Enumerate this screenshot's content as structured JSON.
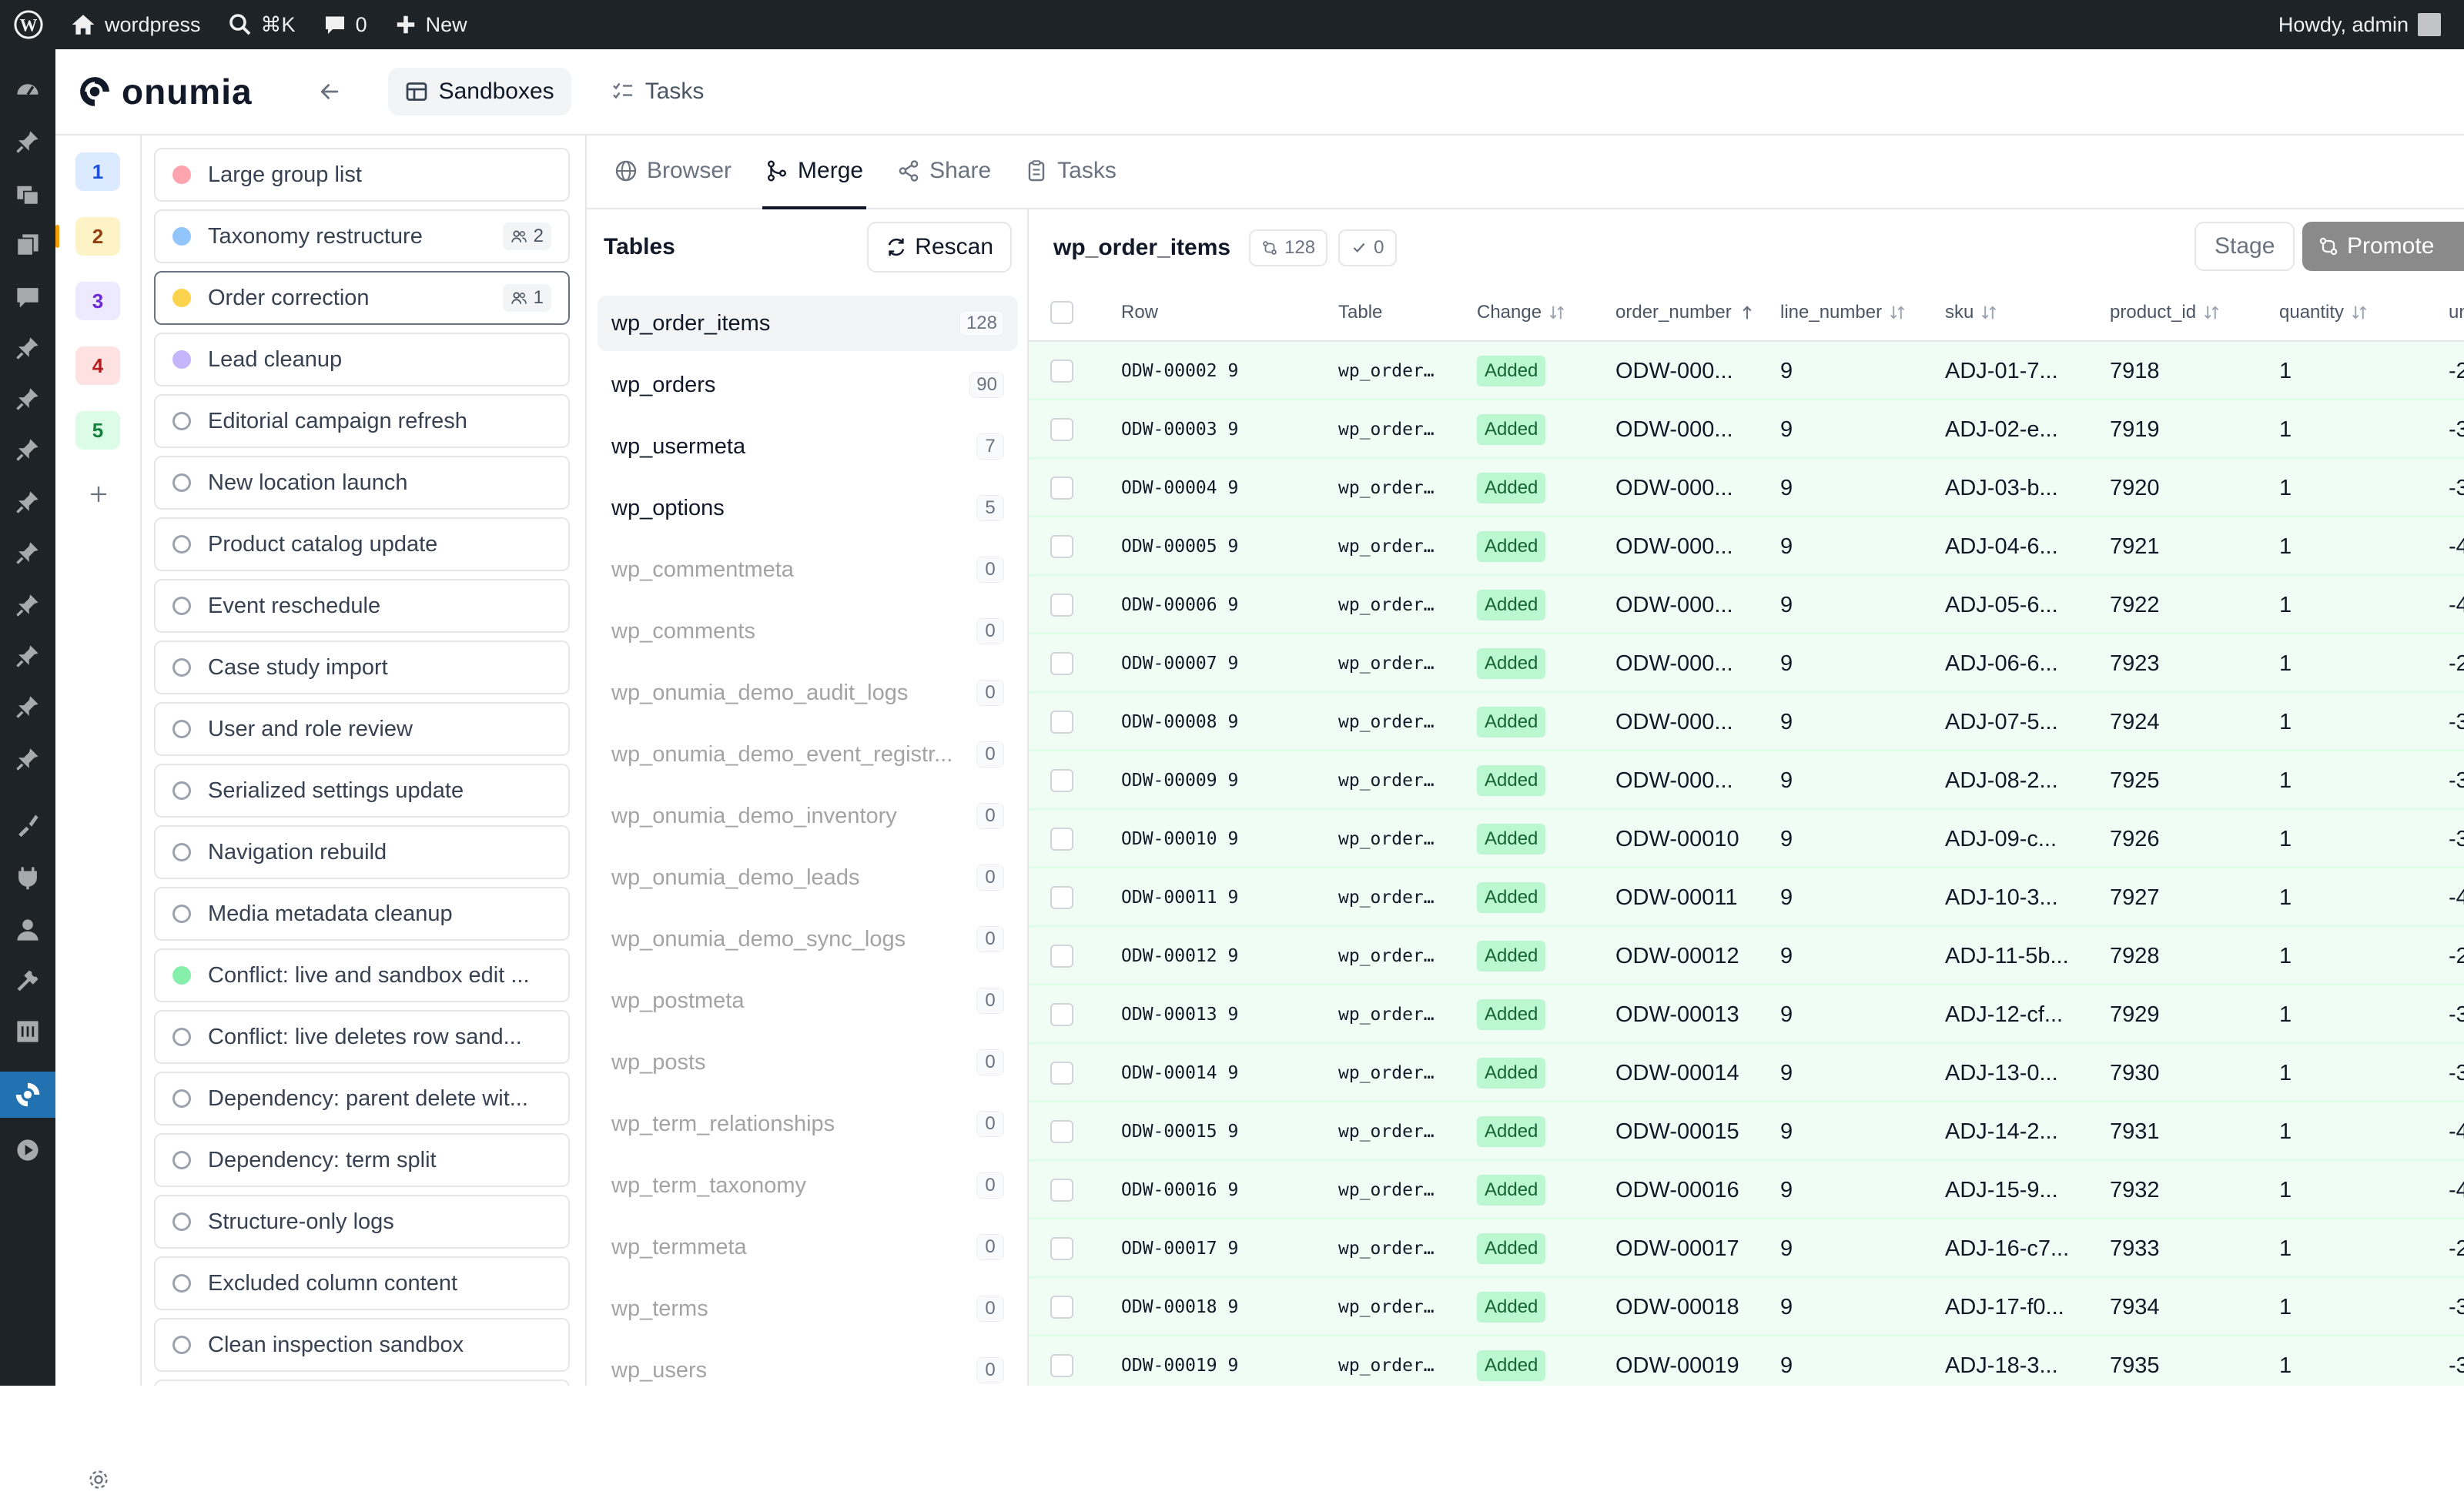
{
  "adminbar": {
    "site_name": "wordpress",
    "search_shortcut": "⌘K",
    "comments_count": "0",
    "new_label": "New",
    "greeting": "Howdy, admin"
  },
  "app": {
    "logo_text": "onumia",
    "tabs": [
      {
        "label": "Sandboxes"
      },
      {
        "label": "Tasks"
      }
    ]
  },
  "rail": {
    "numbers": [
      {
        "label": "1",
        "bg": "#dbeafe",
        "fg": "#1d4ed8"
      },
      {
        "label": "2",
        "bg": "#fef3c7",
        "fg": "#92400e"
      },
      {
        "label": "3",
        "bg": "#ede9fe",
        "fg": "#6d28d9"
      },
      {
        "label": "4",
        "bg": "#fee2e2",
        "fg": "#b91c1c"
      },
      {
        "label": "5",
        "bg": "#dcfce7",
        "fg": "#15803d"
      }
    ]
  },
  "sandboxes": [
    {
      "name": "Large group list",
      "color": "#fda4af"
    },
    {
      "name": "Taxonomy restructure",
      "color": "#93c5fd",
      "members": "2"
    },
    {
      "name": "Order correction",
      "color": "#fcd34d",
      "members": "1"
    },
    {
      "name": "Lead cleanup",
      "color": "#c4b5fd"
    },
    {
      "name": "Editorial campaign refresh"
    },
    {
      "name": "New location launch"
    },
    {
      "name": "Product catalog update"
    },
    {
      "name": "Event reschedule"
    },
    {
      "name": "Case study import"
    },
    {
      "name": "User and role review"
    },
    {
      "name": "Serialized settings update"
    },
    {
      "name": "Navigation rebuild"
    },
    {
      "name": "Media metadata cleanup"
    },
    {
      "name": "Conflict: live and sandbox edit ...",
      "color": "#86efac"
    },
    {
      "name": "Conflict: live deletes row sand..."
    },
    {
      "name": "Dependency: parent delete wit..."
    },
    {
      "name": "Dependency: term split"
    },
    {
      "name": "Structure-only logs"
    },
    {
      "name": "Excluded column content"
    },
    {
      "name": "Clean inspection sandbox"
    }
  ],
  "subtabs": [
    {
      "label": "Browser"
    },
    {
      "label": "Merge"
    },
    {
      "label": "Share"
    },
    {
      "label": "Tasks"
    }
  ],
  "tables_panel": {
    "title": "Tables",
    "rescan_label": "Rescan",
    "tables": [
      {
        "name": "wp_order_items",
        "count": "128"
      },
      {
        "name": "wp_orders",
        "count": "90"
      },
      {
        "name": "wp_usermeta",
        "count": "7"
      },
      {
        "name": "wp_options",
        "count": "5"
      },
      {
        "name": "wp_commentmeta",
        "count": "0"
      },
      {
        "name": "wp_comments",
        "count": "0"
      },
      {
        "name": "wp_onumia_demo_audit_logs",
        "count": "0"
      },
      {
        "name": "wp_onumia_demo_event_registr...",
        "count": "0"
      },
      {
        "name": "wp_onumia_demo_inventory",
        "count": "0"
      },
      {
        "name": "wp_onumia_demo_leads",
        "count": "0"
      },
      {
        "name": "wp_onumia_demo_sync_logs",
        "count": "0"
      },
      {
        "name": "wp_postmeta",
        "count": "0"
      },
      {
        "name": "wp_posts",
        "count": "0"
      },
      {
        "name": "wp_term_relationships",
        "count": "0"
      },
      {
        "name": "wp_term_taxonomy",
        "count": "0"
      },
      {
        "name": "wp_termmeta",
        "count": "0"
      },
      {
        "name": "wp_terms",
        "count": "0"
      },
      {
        "name": "wp_users",
        "count": "0"
      }
    ]
  },
  "data_panel": {
    "table_name": "wp_order_items",
    "changes_count": "128",
    "staged_count": "0",
    "stage_label": "Stage",
    "promote_label": "Promote",
    "columns": [
      "Row",
      "Table",
      "Change",
      "order_number",
      "line_number",
      "sku",
      "product_id",
      "quantity",
      "un"
    ],
    "rows": [
      {
        "row": "ODW-00002 9",
        "table": "wp_order…",
        "change": "Added",
        "order_number": "ODW-000...",
        "line_number": "9",
        "sku": "ADJ-01-7...",
        "product_id": "7918",
        "quantity": "1",
        "unit": "-2"
      },
      {
        "row": "ODW-00003 9",
        "table": "wp_order…",
        "change": "Added",
        "order_number": "ODW-000...",
        "line_number": "9",
        "sku": "ADJ-02-e...",
        "product_id": "7919",
        "quantity": "1",
        "unit": "-3"
      },
      {
        "row": "ODW-00004 9",
        "table": "wp_order…",
        "change": "Added",
        "order_number": "ODW-000...",
        "line_number": "9",
        "sku": "ADJ-03-b...",
        "product_id": "7920",
        "quantity": "1",
        "unit": "-3"
      },
      {
        "row": "ODW-00005 9",
        "table": "wp_order…",
        "change": "Added",
        "order_number": "ODW-000...",
        "line_number": "9",
        "sku": "ADJ-04-6...",
        "product_id": "7921",
        "quantity": "1",
        "unit": "-4"
      },
      {
        "row": "ODW-00006 9",
        "table": "wp_order…",
        "change": "Added",
        "order_number": "ODW-000...",
        "line_number": "9",
        "sku": "ADJ-05-6...",
        "product_id": "7922",
        "quantity": "1",
        "unit": "-4"
      },
      {
        "row": "ODW-00007 9",
        "table": "wp_order…",
        "change": "Added",
        "order_number": "ODW-000...",
        "line_number": "9",
        "sku": "ADJ-06-6...",
        "product_id": "7923",
        "quantity": "1",
        "unit": "-2"
      },
      {
        "row": "ODW-00008 9",
        "table": "wp_order…",
        "change": "Added",
        "order_number": "ODW-000...",
        "line_number": "9",
        "sku": "ADJ-07-5...",
        "product_id": "7924",
        "quantity": "1",
        "unit": "-3"
      },
      {
        "row": "ODW-00009 9",
        "table": "wp_order…",
        "change": "Added",
        "order_number": "ODW-000...",
        "line_number": "9",
        "sku": "ADJ-08-2...",
        "product_id": "7925",
        "quantity": "1",
        "unit": "-3"
      },
      {
        "row": "ODW-00010 9",
        "table": "wp_order…",
        "change": "Added",
        "order_number": "ODW-00010",
        "line_number": "9",
        "sku": "ADJ-09-c...",
        "product_id": "7926",
        "quantity": "1",
        "unit": "-3"
      },
      {
        "row": "ODW-00011 9",
        "table": "wp_order…",
        "change": "Added",
        "order_number": "ODW-00011",
        "line_number": "9",
        "sku": "ADJ-10-3...",
        "product_id": "7927",
        "quantity": "1",
        "unit": "-4"
      },
      {
        "row": "ODW-00012 9",
        "table": "wp_order…",
        "change": "Added",
        "order_number": "ODW-00012",
        "line_number": "9",
        "sku": "ADJ-11-5b...",
        "product_id": "7928",
        "quantity": "1",
        "unit": "-2"
      },
      {
        "row": "ODW-00013 9",
        "table": "wp_order…",
        "change": "Added",
        "order_number": "ODW-00013",
        "line_number": "9",
        "sku": "ADJ-12-cf...",
        "product_id": "7929",
        "quantity": "1",
        "unit": "-3"
      },
      {
        "row": "ODW-00014 9",
        "table": "wp_order…",
        "change": "Added",
        "order_number": "ODW-00014",
        "line_number": "9",
        "sku": "ADJ-13-0...",
        "product_id": "7930",
        "quantity": "1",
        "unit": "-3"
      },
      {
        "row": "ODW-00015 9",
        "table": "wp_order…",
        "change": "Added",
        "order_number": "ODW-00015",
        "line_number": "9",
        "sku": "ADJ-14-2...",
        "product_id": "7931",
        "quantity": "1",
        "unit": "-4"
      },
      {
        "row": "ODW-00016 9",
        "table": "wp_order…",
        "change": "Added",
        "order_number": "ODW-00016",
        "line_number": "9",
        "sku": "ADJ-15-9...",
        "product_id": "7932",
        "quantity": "1",
        "unit": "-4"
      },
      {
        "row": "ODW-00017 9",
        "table": "wp_order…",
        "change": "Added",
        "order_number": "ODW-00017",
        "line_number": "9",
        "sku": "ADJ-16-c7...",
        "product_id": "7933",
        "quantity": "1",
        "unit": "-2"
      },
      {
        "row": "ODW-00018 9",
        "table": "wp_order…",
        "change": "Added",
        "order_number": "ODW-00018",
        "line_number": "9",
        "sku": "ADJ-17-f0...",
        "product_id": "7934",
        "quantity": "1",
        "unit": "-3"
      },
      {
        "row": "ODW-00019 9",
        "table": "wp_order…",
        "change": "Added",
        "order_number": "ODW-00019",
        "line_number": "9",
        "sku": "ADJ-18-3...",
        "product_id": "7935",
        "quantity": "1",
        "unit": "-3"
      }
    ]
  },
  "icons": {
    "admin_menu": [
      "dashboard-icon",
      "pin-icon",
      "media-icon",
      "pages-icon",
      "comments-icon",
      "pin-icon",
      "pin-icon",
      "pin-icon",
      "pin-icon",
      "pin-icon",
      "pin-icon",
      "pin-icon",
      "pin-icon",
      "pin-icon",
      "appearance-icon",
      "plugins-icon",
      "users-icon",
      "tools-icon",
      "settings-icon",
      "onumia-icon",
      "play-icon"
    ]
  }
}
